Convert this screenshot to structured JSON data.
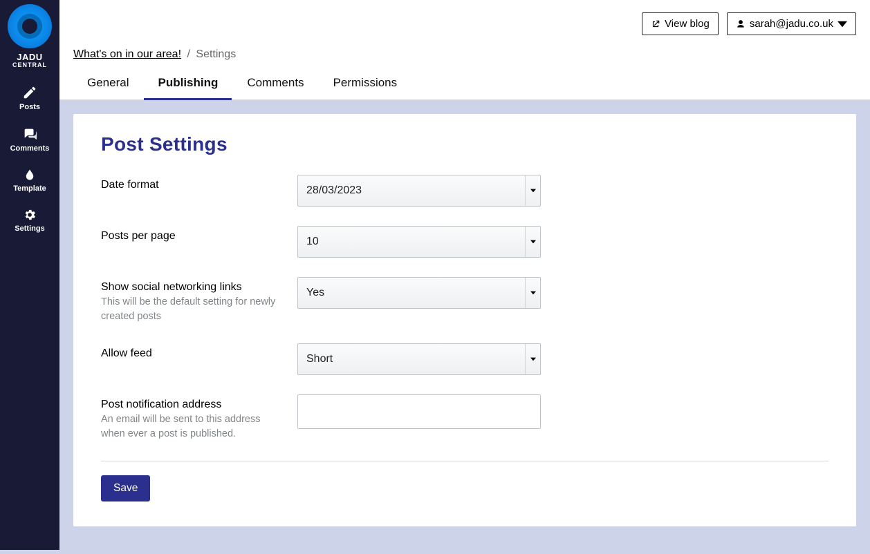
{
  "brand": {
    "name": "JADU",
    "sub": "CENTRAL"
  },
  "sidebar": {
    "items": [
      {
        "label": "Posts"
      },
      {
        "label": "Comments"
      },
      {
        "label": "Template"
      },
      {
        "label": "Settings"
      }
    ]
  },
  "header": {
    "view_blog_label": "View blog",
    "user_email": "sarah@jadu.co.uk"
  },
  "breadcrumb": {
    "link_text": "What's on in our area!",
    "current": "Settings"
  },
  "tabs": [
    {
      "label": "General",
      "active": false
    },
    {
      "label": "Publishing",
      "active": true
    },
    {
      "label": "Comments",
      "active": false
    },
    {
      "label": "Permissions",
      "active": false
    }
  ],
  "page": {
    "title": "Post Settings",
    "save_label": "Save"
  },
  "form": {
    "date_format": {
      "label": "Date format",
      "value": "28/03/2023"
    },
    "posts_per_page": {
      "label": "Posts per page",
      "value": "10"
    },
    "social_links": {
      "label": "Show social networking links",
      "hint": "This will be the default setting for newly created posts",
      "value": "Yes"
    },
    "allow_feed": {
      "label": "Allow feed",
      "value": "Short"
    },
    "notify": {
      "label": "Post notification address",
      "hint": "An email will be sent to this address when ever a post is published.",
      "value": ""
    }
  }
}
